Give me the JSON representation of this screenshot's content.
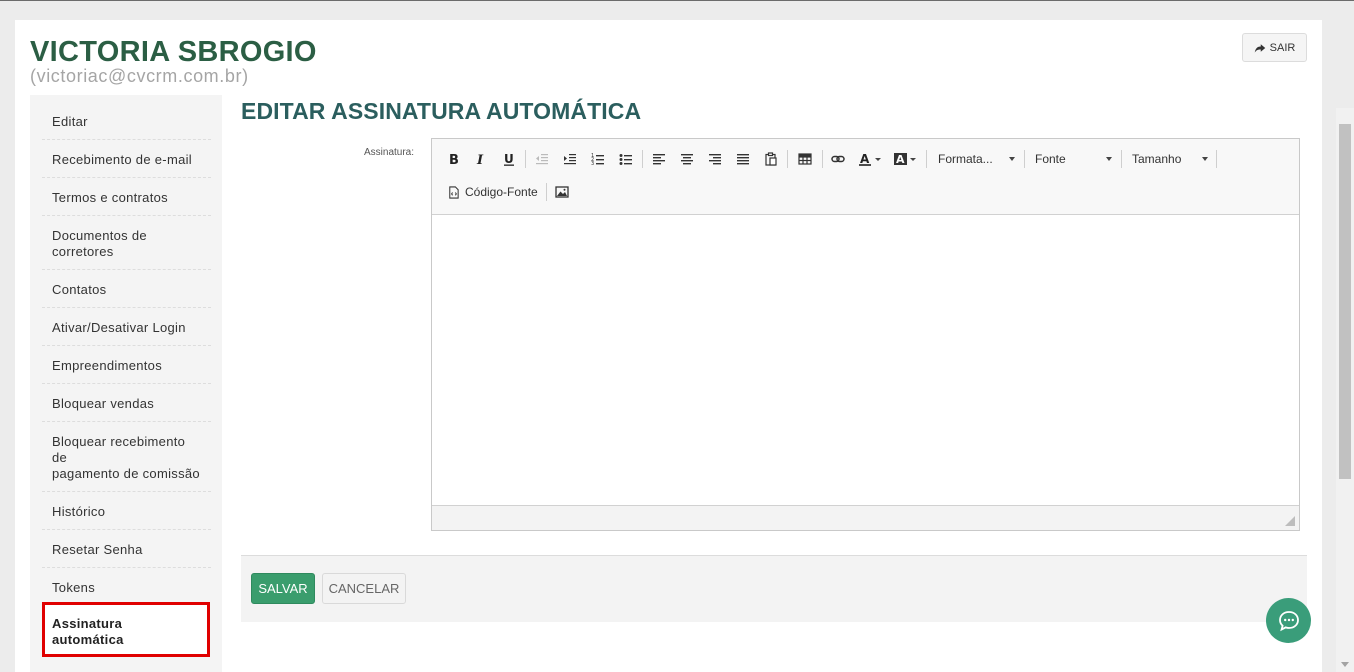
{
  "user": {
    "name": "VICTORIA SBROGIO",
    "email": "(victoriac@cvcrm.com.br)"
  },
  "header": {
    "logout_label": "SAIR",
    "logout_icon": "share-forward-icon"
  },
  "sidebar": {
    "items": [
      {
        "label": "Editar"
      },
      {
        "label": "Recebimento de e-mail"
      },
      {
        "label": "Termos e contratos"
      },
      {
        "label": "Documentos de",
        "label2": "corretores"
      },
      {
        "label": "Contatos"
      },
      {
        "label": "Ativar/Desativar Login"
      },
      {
        "label": "Empreendimentos"
      },
      {
        "label": "Bloquear vendas"
      },
      {
        "label": "Bloquear recebimento",
        "label2": "de",
        "label3": "pagamento de comissão"
      },
      {
        "label": "Histórico"
      },
      {
        "label": "Resetar Senha"
      },
      {
        "label": "Tokens"
      }
    ],
    "active": {
      "label": "Assinatura",
      "label2": "automática"
    }
  },
  "main": {
    "title": "EDITAR ASSINATURA AUTOMÁTICA",
    "field_label": "Assinatura:",
    "editor": {
      "format_label": "Formata...",
      "font_label": "Fonte",
      "size_label": "Tamanho",
      "source_label": "Código-Fonte",
      "content": ""
    },
    "save_label": "SALVAR",
    "cancel_label": "CANCELAR"
  },
  "colors": {
    "brand_green": "#2b5e44",
    "save_button": "#3a9d6d",
    "active_border": "#e00000",
    "chat_button": "#3a9d7a"
  }
}
